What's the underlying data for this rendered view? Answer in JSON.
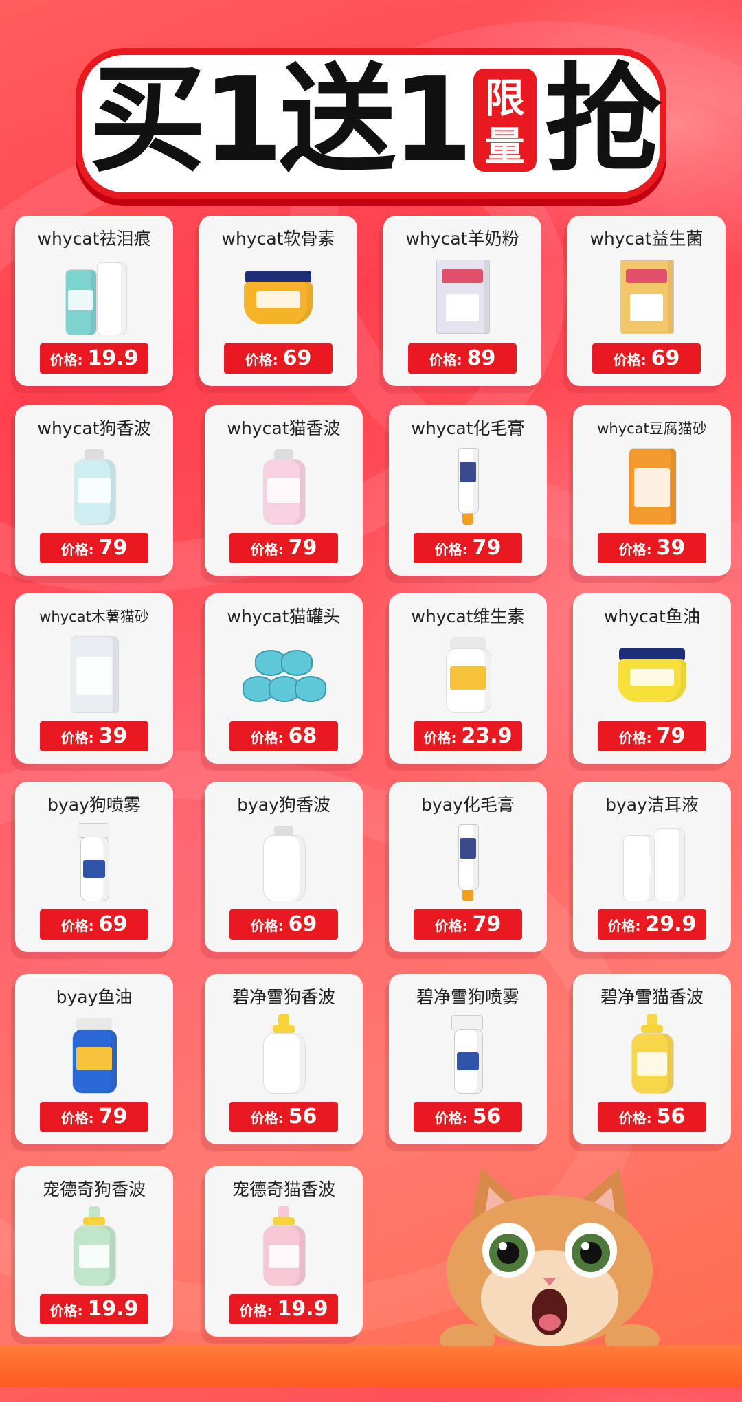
{
  "header": {
    "part1": "买1送1",
    "badge_top": "限",
    "badge_bottom": "量",
    "part2": "抢"
  },
  "price_label": "价格:",
  "products": [
    {
      "name": "whycat祛泪痕",
      "price": "19.9",
      "color": "#7fd3cf",
      "shape": "bottles"
    },
    {
      "name": "whycat软骨素",
      "price": "69",
      "color": "#f5b32a",
      "shape": "jar"
    },
    {
      "name": "whycat羊奶粉",
      "price": "89",
      "color": "#e6e3f0",
      "shape": "box"
    },
    {
      "name": "whycat益生菌",
      "price": "69",
      "color": "#f4c66a",
      "shape": "box"
    },
    {
      "name": "whycat狗香波",
      "price": "79",
      "color": "#cfeef2",
      "shape": "bottle"
    },
    {
      "name": "whycat猫香波",
      "price": "79",
      "color": "#f7d1e2",
      "shape": "bottle"
    },
    {
      "name": "whycat化毛膏",
      "price": "79",
      "color": "#ffffff",
      "shape": "tube"
    },
    {
      "name": "whycat豆腐猫砂",
      "price": "39",
      "color": "#f29a2e",
      "shape": "bag"
    },
    {
      "name": "whycat木薯猫砂",
      "price": "39",
      "color": "#e9edf2",
      "shape": "bag"
    },
    {
      "name": "whycat猫罐头",
      "price": "68",
      "color": "#5ec7d8",
      "shape": "cans"
    },
    {
      "name": "whycat维生素",
      "price": "23.9",
      "color": "#ffffff",
      "shape": "jar-tall"
    },
    {
      "name": "whycat鱼油",
      "price": "79",
      "color": "#f8e03a",
      "shape": "jar"
    },
    {
      "name": "byay狗喷雾",
      "price": "69",
      "color": "#ffffff",
      "shape": "spray"
    },
    {
      "name": "byay狗香波",
      "price": "69",
      "color": "#ffffff",
      "shape": "bottle"
    },
    {
      "name": "byay化毛膏",
      "price": "79",
      "color": "#ffffff",
      "shape": "tube"
    },
    {
      "name": "byay洁耳液",
      "price": "29.9",
      "color": "#ffffff",
      "shape": "bottles"
    },
    {
      "name": "byay鱼油",
      "price": "79",
      "color": "#2a6ad8",
      "shape": "jar-tall"
    },
    {
      "name": "碧净雪狗香波",
      "price": "56",
      "color": "#ffffff",
      "shape": "pump"
    },
    {
      "name": "碧净雪狗喷雾",
      "price": "56",
      "color": "#ffffff",
      "shape": "spray"
    },
    {
      "name": "碧净雪猫香波",
      "price": "56",
      "color": "#f8d64a",
      "shape": "pump"
    },
    {
      "name": "宠德奇狗香波",
      "price": "19.9",
      "color": "#bfe6c8",
      "shape": "pump"
    },
    {
      "name": "宠德奇猫香波",
      "price": "19.9",
      "color": "#f7c7d6",
      "shape": "pump"
    }
  ]
}
